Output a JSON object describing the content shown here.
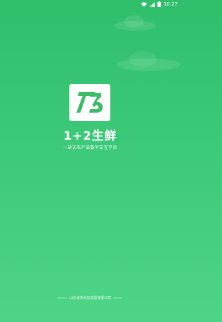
{
  "status_bar": {
    "time": "10:27",
    "icons": [
      "wifi-icon",
      "signal-icon",
      "battery-icon"
    ]
  },
  "app": {
    "logo_icon": "logo-icon",
    "title": "1+2生鲜",
    "subtitle": "一站式农产品数字交互平台"
  },
  "footer": {
    "company": "山东省农科技发展有限公司"
  },
  "colors": {
    "background_top": "#2fbf6b",
    "background_bottom": "#4fd487",
    "logo_green": "#3dbb69",
    "text": "#ffffff"
  }
}
